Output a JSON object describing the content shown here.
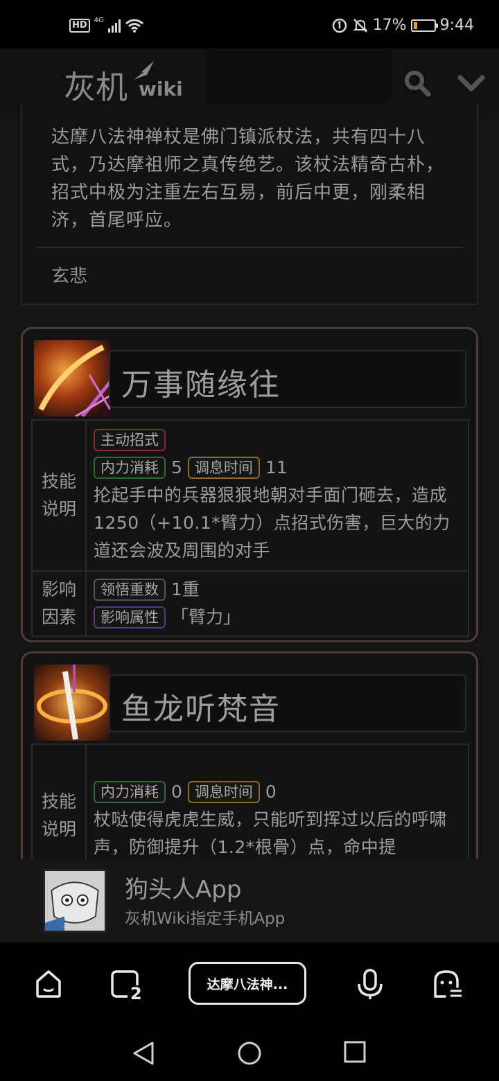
{
  "status_bar": {
    "network": "4G",
    "hd": "HD",
    "battery_percent": "17%",
    "battery_level": 0.17,
    "time": "9:44"
  },
  "header": {
    "logo_main": "灰机",
    "logo_wiki": "wiki"
  },
  "intro": {
    "text": "达摩八法神禅杖是佛门镇派杖法，共有四十八式，乃达摩祖师之真传绝艺。该杖法精奇古朴，招式中极为注重左右互易，前后中更，刚柔相济，首尾呼应。",
    "author": "玄悲"
  },
  "skills": [
    {
      "name": "万事随缘往",
      "label_desc": "技能说明",
      "label_factor": "影响因素",
      "tag_active": "主动招式",
      "tag_cost": "内力消耗",
      "cost": "5",
      "tag_cool": "调息时间",
      "cool": "11",
      "description": "抡起手中的兵器狠狠地朝对手面门砸去，造成1250（+10.1*臂力）点招式伤害，巨大的力道还会波及周围的对手",
      "tag_level": "领悟重数",
      "level": "1重",
      "tag_attr": "影响属性",
      "attr": "「臂力」"
    },
    {
      "name": "鱼龙听梵音",
      "label_desc": "技能说明",
      "tag_cost": "内力消耗",
      "cost": "0",
      "tag_cool": "调息时间",
      "cool": "0",
      "description": "杖哒使得虎虎生威，只能听到挥过以后的呼啸声，防御提升（1.2*根骨）点，命中提"
    }
  ],
  "app_banner": {
    "name": "狗头人App",
    "subtitle": "灰机Wiki指定手机App"
  },
  "browser": {
    "tab_count": "2",
    "current_tab": "达摩八法神..."
  }
}
